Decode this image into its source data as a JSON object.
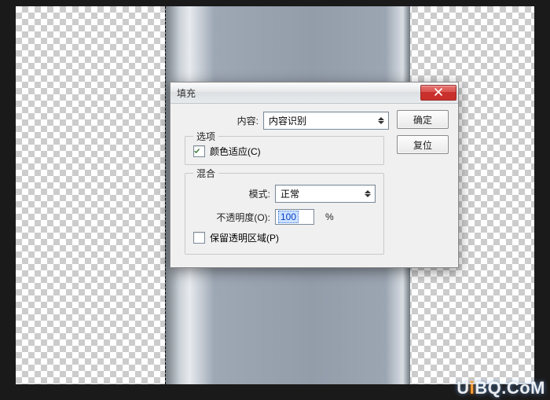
{
  "dialog": {
    "title": "填充",
    "content_label": "内容:",
    "content_value": "内容识别",
    "ok_label": "确定",
    "reset_label": "复位",
    "options_legend": "选项",
    "color_adapt_label": "颜色适应(C)",
    "color_adapt_checked": true,
    "blend_legend": "混合",
    "mode_label": "模式:",
    "mode_value": "正常",
    "opacity_label": "不透明度(O):",
    "opacity_value": "100",
    "opacity_suffix": "%",
    "preserve_transparency_label": "保留透明区域(P)",
    "preserve_transparency_checked": false
  },
  "watermark": {
    "prefix": "U",
    "accent": "i",
    "suffix": "BQ.CoM"
  }
}
